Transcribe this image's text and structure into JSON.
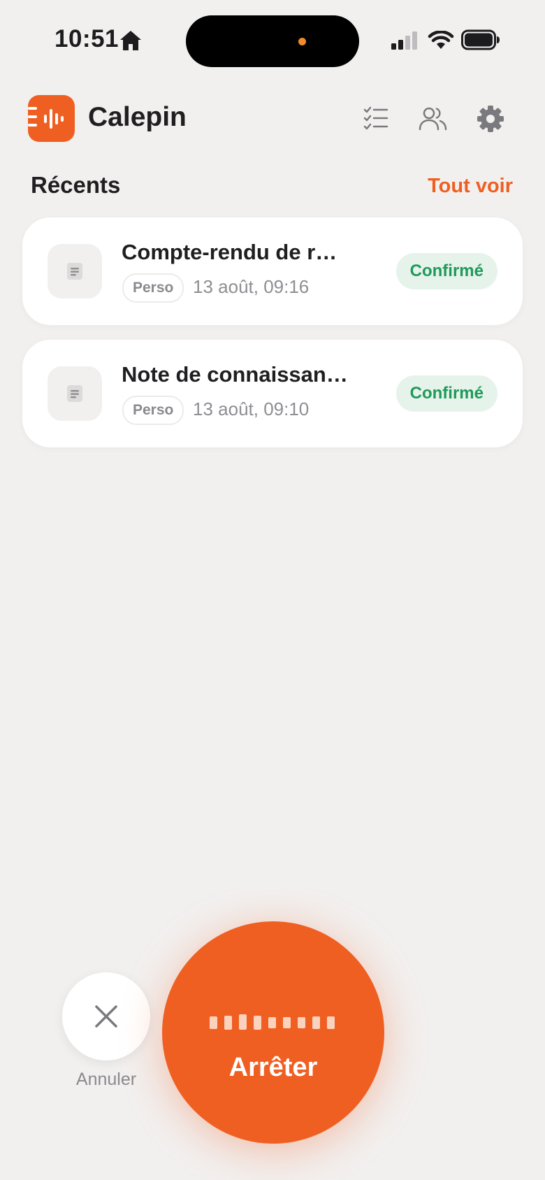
{
  "status_bar": {
    "time": "10:51"
  },
  "header": {
    "app_name": "Calepin"
  },
  "section": {
    "title": "Récents",
    "see_all": "Tout voir"
  },
  "notes": [
    {
      "title": "Compte-rendu de r…",
      "tag": "Perso",
      "date": "13 août, 09:16",
      "status": "Confirmé"
    },
    {
      "title": "Note de connaissan…",
      "tag": "Perso",
      "date": "13 août, 09:10",
      "status": "Confirmé"
    }
  ],
  "controls": {
    "cancel_label": "Annuler",
    "stop_label": "Arrêter"
  },
  "colors": {
    "accent": "#f05f22",
    "status_green": "#1f9a5a",
    "status_bg": "#e6f3ea",
    "background": "#f2f0ef"
  },
  "icons": [
    "home-icon",
    "signal-icon",
    "wifi-icon",
    "battery-icon",
    "app-logo-icon",
    "checklist-icon",
    "people-icon",
    "gear-icon",
    "document-icon",
    "close-icon",
    "waveform-icon"
  ]
}
